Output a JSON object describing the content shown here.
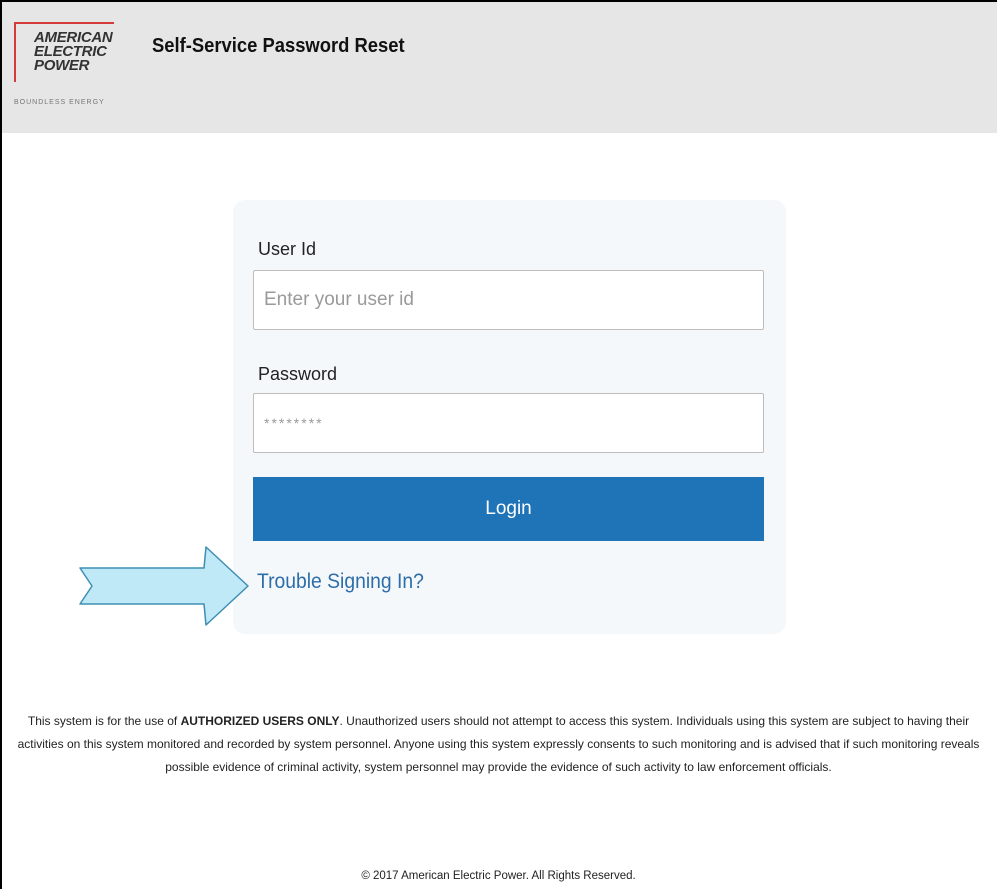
{
  "header": {
    "logo_lines": [
      "AMERICAN",
      "ELECTRIC",
      "POWER"
    ],
    "logo_tagline": "BOUNDLESS ENERGY",
    "title": "Self-Service Password Reset"
  },
  "login_form": {
    "user_id_label": "User Id",
    "user_id_placeholder": "Enter your user id",
    "password_label": "Password",
    "password_placeholder": "********",
    "login_label": "Login",
    "trouble_link": "Trouble Signing In?"
  },
  "notice": {
    "line1_pre": "This system is for the use of ",
    "line1_strong": "AUTHORIZED USERS ONLY",
    "line1_post": ". Unauthorized users should not attempt to access this system. Individuals using this system are subject to having their",
    "line2": "activities on this system monitored and recorded by system personnel. Anyone using this system expressly consents to such monitoring and is advised that if such monitoring reveals",
    "line3": "possible evidence of criminal activity, system personnel may provide the evidence of such activity to law enforcement officials."
  },
  "footer": {
    "copyright": "© 2017 American Electric Power. All Rights Reserved."
  },
  "colors": {
    "header_bg": "#e6e6e6",
    "card_bg": "#f5f8fb",
    "button_bg": "#1f73b7",
    "link": "#2d6ea8",
    "arrow_fill": "#bfe9f7",
    "arrow_stroke": "#3f8fb3",
    "logo_accent": "#d43c3c"
  }
}
